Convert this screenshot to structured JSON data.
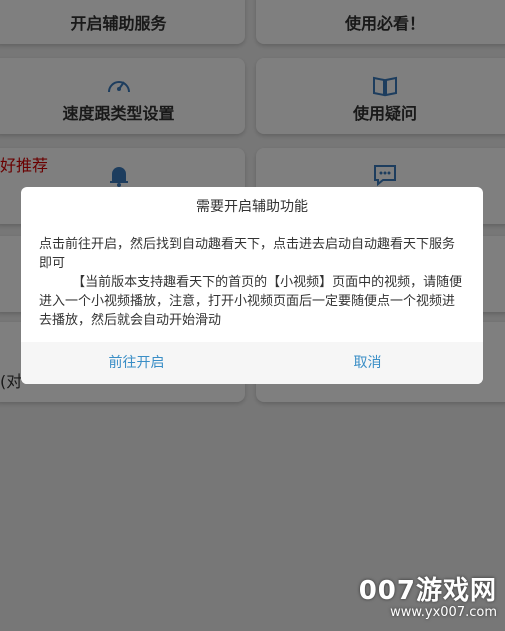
{
  "cards": {
    "enable_service": "开启辅助服务",
    "must_read": "使用必看！",
    "speed_settings": "速度跟类型设置",
    "faq": "使用疑问"
  },
  "recommend_text": "好推荐",
  "partial_text": "(对",
  "dialog": {
    "title": "需要开启辅助功能",
    "message": "点击前往开启，然后找到自动趣看天下，点击进去启动自动趣看天下服务即可\n        【当前版本支持趣看天下的首页的【小视频】页面中的视频，请随便进入一个小视频播放，注意，打开小视频页面后一定要随便点一个视频进去播放，然后就会自动开始滑动",
    "go_button": "前往开启",
    "cancel_button": "取消"
  },
  "watermark": {
    "brand": "007游戏网",
    "url": "www.yx007.com"
  }
}
